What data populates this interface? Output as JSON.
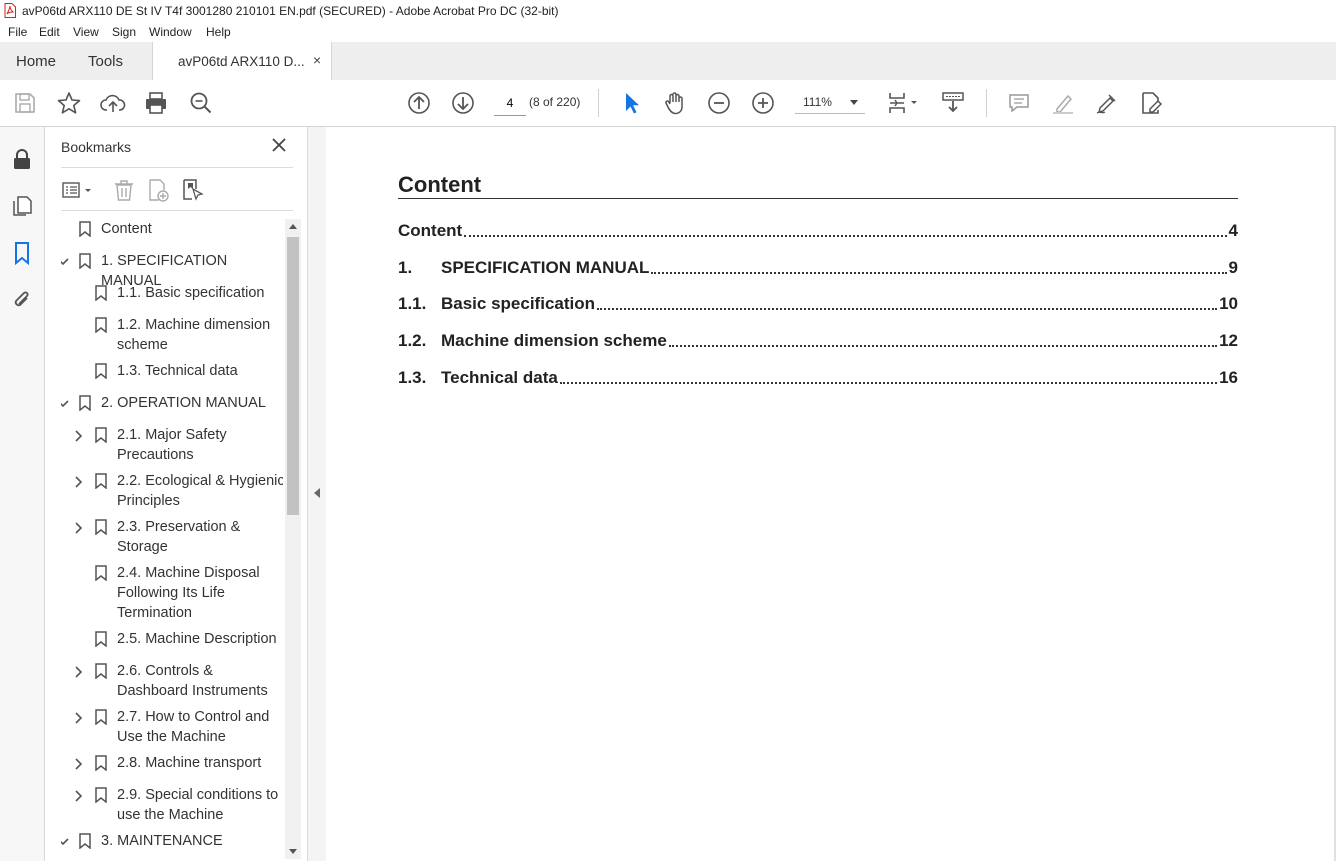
{
  "window": {
    "title": "avP06td ARX110 DE St IV T4f 3001280 210101 EN.pdf (SECURED) - Adobe Acrobat Pro DC (32-bit)"
  },
  "menu": [
    "File",
    "Edit",
    "View",
    "Sign",
    "Window",
    "Help"
  ],
  "tabs": {
    "home": "Home",
    "tools": "Tools",
    "document": "avP06td ARX110 D...",
    "close_glyph": "×"
  },
  "toolbar": {
    "page_value": "4",
    "page_count": "(8 of 220)",
    "zoom": "111%"
  },
  "bookmarks": {
    "title": "Bookmarks",
    "items": [
      {
        "label": "Content",
        "level": 0,
        "chevron": "none"
      },
      {
        "label": "1. SPECIFICATION MANUAL",
        "level": 0,
        "chevron": "down"
      },
      {
        "label": "1.1. Basic specification",
        "level": 1,
        "chevron": "none"
      },
      {
        "label": "1.2. Machine dimension scheme",
        "level": 1,
        "chevron": "none"
      },
      {
        "label": "1.3. Technical data",
        "level": 1,
        "chevron": "none"
      },
      {
        "label": "2. OPERATION MANUAL",
        "level": 0,
        "chevron": "down"
      },
      {
        "label": "2.1. Major Safety Precautions",
        "level": 1,
        "chevron": "right"
      },
      {
        "label": "2.2. Ecological & Hygienic Principles",
        "level": 1,
        "chevron": "right"
      },
      {
        "label": "2.3. Preservation & Storage",
        "level": 1,
        "chevron": "right"
      },
      {
        "label": "2.4. Machine Disposal Following Its Life Termination",
        "level": 1,
        "chevron": "none"
      },
      {
        "label": "2.5. Machine Description",
        "level": 1,
        "chevron": "none"
      },
      {
        "label": "2.6. Controls & Dashboard Instruments",
        "level": 1,
        "chevron": "right"
      },
      {
        "label": "2.7. How to Control and Use the Machine",
        "level": 1,
        "chevron": "right"
      },
      {
        "label": "2.8. Machine transport",
        "level": 1,
        "chevron": "right"
      },
      {
        "label": "2.9. Special conditions to use the Machine",
        "level": 1,
        "chevron": "right"
      },
      {
        "label": "3. MAINTENANCE",
        "level": 0,
        "chevron": "down"
      }
    ]
  },
  "document": {
    "heading": "Content",
    "toc": [
      {
        "num": "",
        "text": "Content",
        "page": "4"
      },
      {
        "num": "1.",
        "text": "SPECIFICATION MANUAL",
        "page": "9"
      },
      {
        "num": "1.1.",
        "text": "Basic specification",
        "page": "10"
      },
      {
        "num": "1.2.",
        "text": "Machine dimension scheme",
        "page": "12"
      },
      {
        "num": "1.3.",
        "text": "Technical data",
        "page": "16"
      }
    ]
  },
  "colors": {
    "accent_blue": "#1473e6",
    "pdf_red": "#d4261c"
  }
}
